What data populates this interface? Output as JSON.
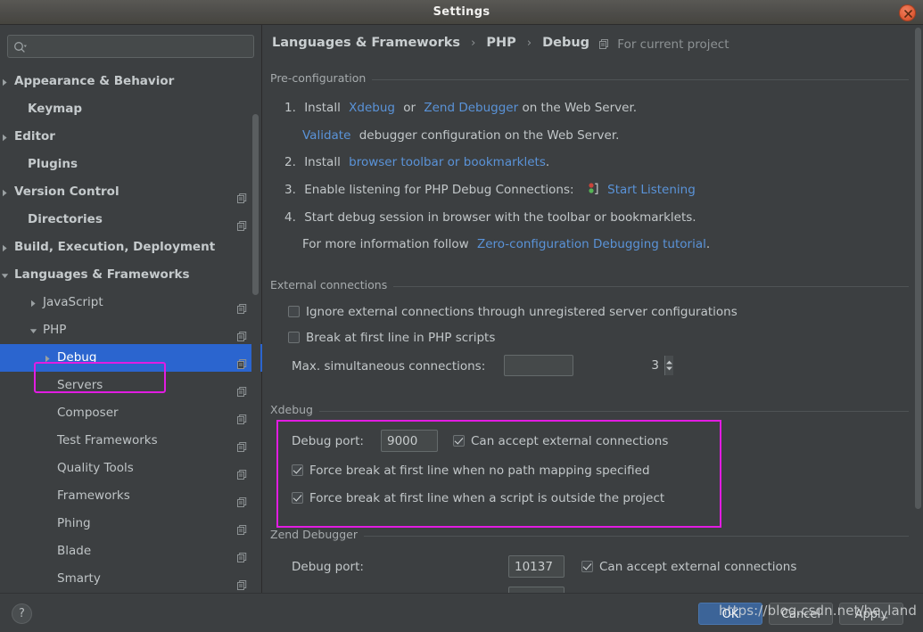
{
  "window": {
    "title": "Settings",
    "close_icon": "close-icon"
  },
  "colors": {
    "accent_selection": "#2b65cf",
    "annotation": "#e21ce2",
    "link": "#5a93d8",
    "panel_bg": "#3c3f41",
    "primary_button": "#3c6498"
  },
  "sidebar": {
    "search": {
      "value": "",
      "placeholder": ""
    },
    "items": [
      {
        "label": "Appearance & Behavior",
        "indent": 16,
        "arrow": "right",
        "bold": true,
        "module_icon": false,
        "selected": false
      },
      {
        "label": "Keymap",
        "indent": 31,
        "arrow": "none",
        "bold": true,
        "module_icon": false,
        "selected": false
      },
      {
        "label": "Editor",
        "indent": 16,
        "arrow": "right",
        "bold": true,
        "module_icon": false,
        "selected": false
      },
      {
        "label": "Plugins",
        "indent": 31,
        "arrow": "none",
        "bold": true,
        "module_icon": false,
        "selected": false
      },
      {
        "label": "Version Control",
        "indent": 16,
        "arrow": "right",
        "bold": true,
        "module_icon": true,
        "selected": false
      },
      {
        "label": "Directories",
        "indent": 31,
        "arrow": "none",
        "bold": true,
        "module_icon": true,
        "selected": false
      },
      {
        "label": "Build, Execution, Deployment",
        "indent": 16,
        "arrow": "right",
        "bold": true,
        "module_icon": false,
        "selected": false
      },
      {
        "label": "Languages & Frameworks",
        "indent": 16,
        "arrow": "down",
        "bold": true,
        "module_icon": false,
        "selected": false
      },
      {
        "label": "JavaScript",
        "indent": 48,
        "arrow": "right",
        "bold": false,
        "module_icon": true,
        "selected": false
      },
      {
        "label": "PHP",
        "indent": 48,
        "arrow": "down",
        "bold": false,
        "module_icon": true,
        "selected": false
      },
      {
        "label": "Debug",
        "indent": 64,
        "arrow": "right",
        "bold": false,
        "module_icon": true,
        "selected": true
      },
      {
        "label": "Servers",
        "indent": 64,
        "arrow": "none",
        "bold": false,
        "module_icon": true,
        "selected": false
      },
      {
        "label": "Composer",
        "indent": 64,
        "arrow": "none",
        "bold": false,
        "module_icon": true,
        "selected": false
      },
      {
        "label": "Test Frameworks",
        "indent": 64,
        "arrow": "none",
        "bold": false,
        "module_icon": true,
        "selected": false
      },
      {
        "label": "Quality Tools",
        "indent": 64,
        "arrow": "none",
        "bold": false,
        "module_icon": true,
        "selected": false
      },
      {
        "label": "Frameworks",
        "indent": 64,
        "arrow": "none",
        "bold": false,
        "module_icon": true,
        "selected": false
      },
      {
        "label": "Phing",
        "indent": 64,
        "arrow": "none",
        "bold": false,
        "module_icon": true,
        "selected": false
      },
      {
        "label": "Blade",
        "indent": 64,
        "arrow": "none",
        "bold": false,
        "module_icon": true,
        "selected": false
      },
      {
        "label": "Smarty",
        "indent": 64,
        "arrow": "none",
        "bold": false,
        "module_icon": true,
        "selected": false
      }
    ]
  },
  "header": {
    "breadcrumb": [
      "Languages & Frameworks",
      "PHP",
      "Debug"
    ],
    "separator": "›",
    "for_current_project": "For current project"
  },
  "preconfiguration": {
    "group_title": "Pre-configuration",
    "step1_num": "1.",
    "step1_install": "Install",
    "step1_link_xdebug": "Xdebug",
    "step1_or": "or",
    "step1_link_zend": "Zend Debugger",
    "step1_tail": "on the Web Server.",
    "validate_link": "Validate",
    "validate_tail": "debugger configuration on the Web Server.",
    "step2_num": "2.",
    "step2_install": "Install",
    "step2_link": "browser toolbar or bookmarklets",
    "step2_tail": ".",
    "step3_num": "3.",
    "step3_text": "Enable listening for PHP Debug Connections:",
    "step3_link": "Start Listening",
    "step3_icon": "start-listening-icon",
    "step4_num": "4.",
    "step4_text": "Start debug session in browser with the toolbar or bookmarklets.",
    "more_info_prefix": "For more information follow",
    "more_info_link": "Zero-configuration Debugging tutorial",
    "more_info_tail": "."
  },
  "external_connections": {
    "group_title": "External connections",
    "ignore_label": "Ignore external connections through unregistered server configurations",
    "ignore_checked": false,
    "break_label": "Break at first line in PHP scripts",
    "break_checked": false,
    "max_conn_label": "Max. simultaneous connections:",
    "max_conn_value": "3"
  },
  "xdebug": {
    "group_title": "Xdebug",
    "debug_port_label": "Debug port:",
    "debug_port_value": "9000",
    "accept_ext_label": "Can accept external connections",
    "accept_ext_checked": true,
    "force_break_no_mapping_label": "Force break at first line when no path mapping specified",
    "force_break_no_mapping_checked": true,
    "force_break_outside_label": "Force break at first line when a script is outside the project",
    "force_break_outside_checked": true
  },
  "zend_debugger": {
    "group_title": "Zend Debugger",
    "debug_port_label": "Debug port:",
    "debug_port_value": "10137",
    "accept_ext_label": "Can accept external connections",
    "accept_ext_checked": true
  },
  "footer": {
    "help_label": "?",
    "ok_label": "OK",
    "cancel_label": "Cancel",
    "apply_label": "Apply"
  },
  "overlay": {
    "watermark": "https://blog.csdn.net/he_land"
  }
}
